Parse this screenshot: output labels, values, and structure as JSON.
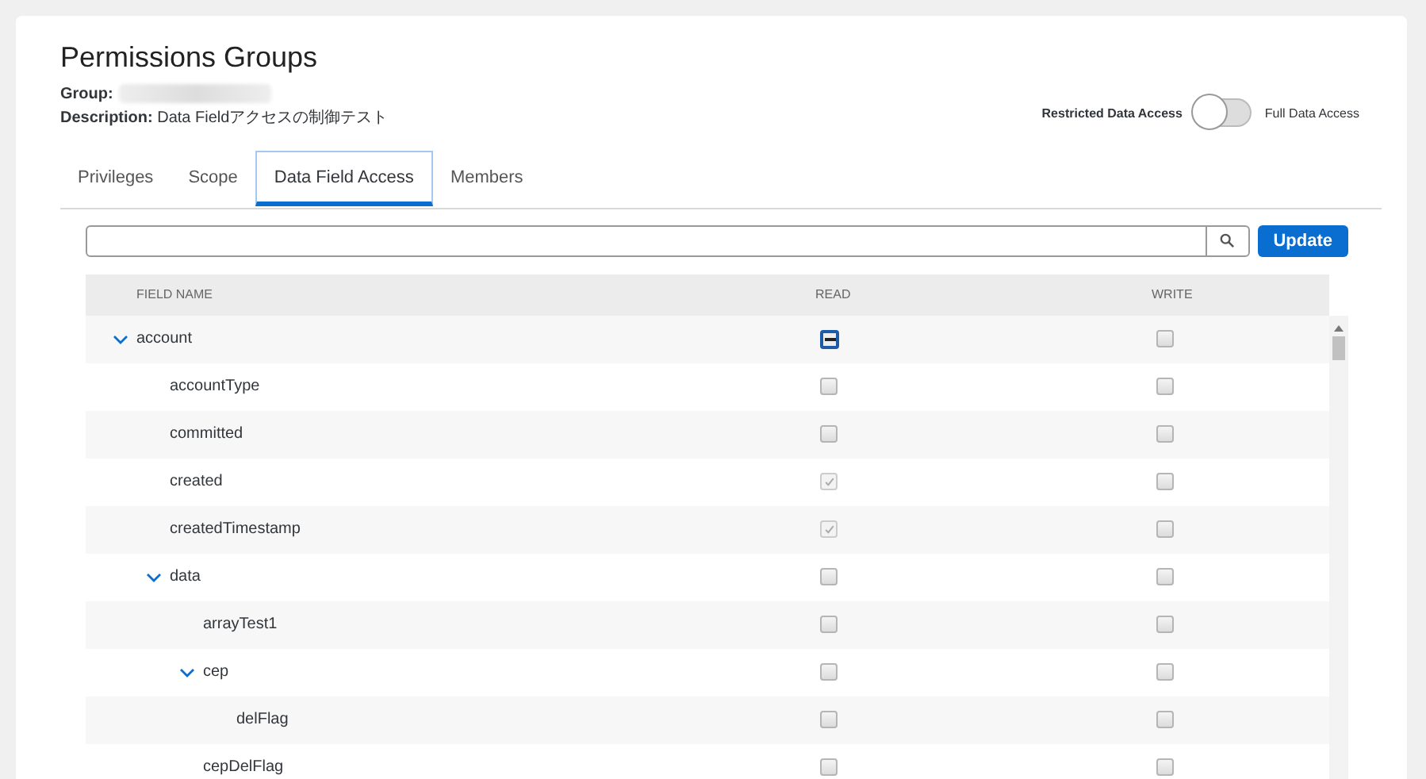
{
  "page": {
    "title": "Permissions Groups",
    "group_label": "Group:",
    "description_label": "Description:",
    "description": "Data Fieldアクセスの制御テスト"
  },
  "access_toggle": {
    "left_label": "Restricted Data Access",
    "right_label": "Full Data Access",
    "on": false
  },
  "tabs": [
    {
      "label": "Privileges",
      "selected": false
    },
    {
      "label": "Scope",
      "selected": false
    },
    {
      "label": "Data Field Access",
      "selected": true
    },
    {
      "label": "Members",
      "selected": false
    }
  ],
  "search": {
    "button": "Update"
  },
  "table": {
    "columns": [
      "FIELD NAME",
      "READ",
      "WRITE"
    ],
    "rows": [
      {
        "name": "account",
        "expanded": true,
        "read_checked": false,
        "read_indeterminate": true,
        "read_disabled": false,
        "write_checked": false,
        "children": [
          {
            "name": "accountType",
            "read_checked": false,
            "read_indeterminate": false,
            "read_disabled": false,
            "write_checked": false
          },
          {
            "name": "committed",
            "read_checked": false,
            "read_indeterminate": false,
            "read_disabled": false,
            "write_checked": false
          },
          {
            "name": "created",
            "read_checked": true,
            "read_indeterminate": false,
            "read_disabled": true,
            "write_checked": false
          },
          {
            "name": "createdTimestamp",
            "read_checked": true,
            "read_indeterminate": false,
            "read_disabled": true,
            "write_checked": false
          },
          {
            "name": "data",
            "expanded": true,
            "read_checked": false,
            "read_indeterminate": false,
            "read_disabled": false,
            "write_checked": false,
            "children": [
              {
                "name": "arrayTest1",
                "read_checked": false,
                "read_indeterminate": false,
                "read_disabled": false,
                "write_checked": false
              },
              {
                "name": "cep",
                "expanded": true,
                "read_checked": false,
                "read_indeterminate": false,
                "read_disabled": false,
                "write_checked": false,
                "children": [
                  {
                    "name": "delFlag",
                    "read_checked": false,
                    "read_indeterminate": false,
                    "read_disabled": false,
                    "write_checked": false
                  }
                ]
              },
              {
                "name": "cepDelFlag",
                "read_checked": false,
                "read_indeterminate": false,
                "read_disabled": false,
                "write_checked": false
              }
            ]
          }
        ]
      }
    ]
  }
}
